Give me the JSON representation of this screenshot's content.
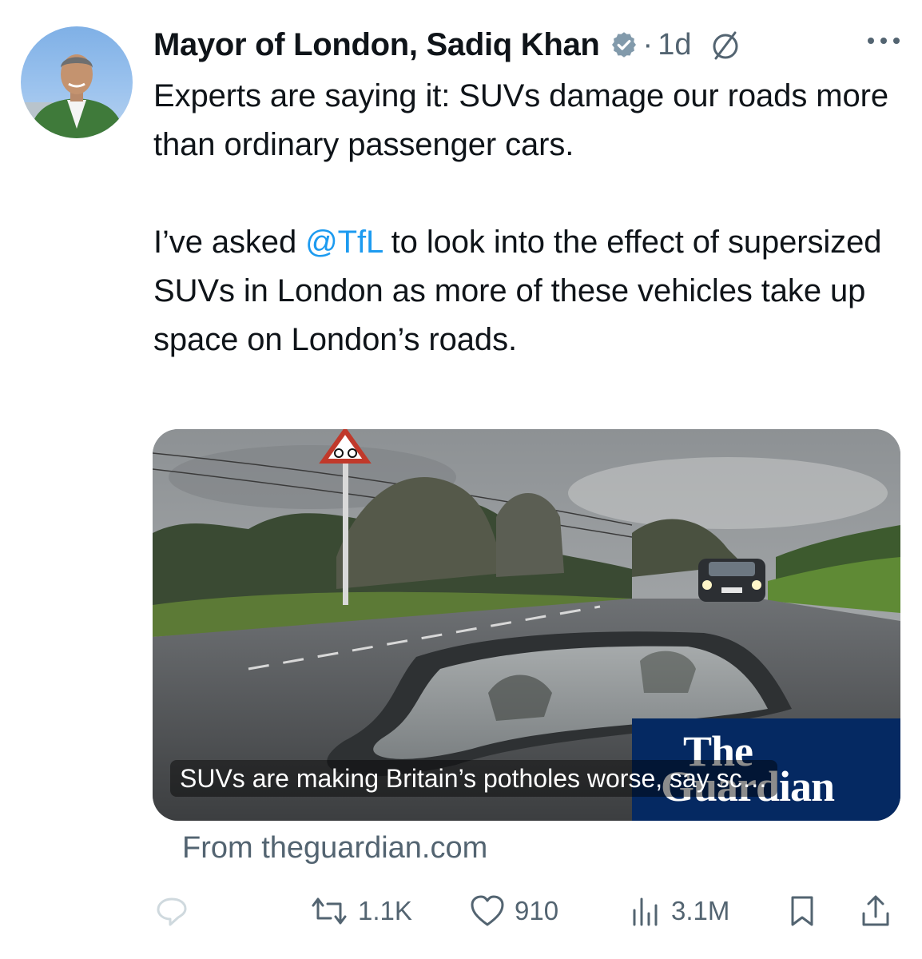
{
  "author": {
    "name": "Mayor of London, Sadiq Khan",
    "verified_icon": "verified-badge-icon",
    "time": "1d",
    "separator": "·",
    "extra_icon": "circle-slash-icon",
    "more_icon": "more-options-icon"
  },
  "tweet": {
    "line1": "Experts are saying it: SUVs damage our roads more than ordinary passenger cars.",
    "line2_prefix": "I’ve asked ",
    "mention": "@TfL",
    "line2_suffix": " to look into the effect of supersized SUVs in London as more of these vehicles take up space on London’s roads."
  },
  "card": {
    "headline": "SUVs are making Britain’s potholes worse, say sc…",
    "brand_line1": "The",
    "brand_line2": "Guardian",
    "source": "From theguardian.com"
  },
  "actions": {
    "reply": {
      "icon": "reply-icon",
      "count": ""
    },
    "retweet": {
      "icon": "retweet-icon",
      "count": "1.1K"
    },
    "like": {
      "icon": "heart-icon",
      "count": "910"
    },
    "views": {
      "icon": "views-bar-chart-icon",
      "count": "3.1M"
    },
    "bookmark": {
      "icon": "bookmark-icon"
    },
    "share": {
      "icon": "share-icon"
    }
  },
  "colors": {
    "text": "#0f1419",
    "muted": "#536471",
    "link": "#1d9bf0",
    "guardian_blue": "#052962"
  }
}
